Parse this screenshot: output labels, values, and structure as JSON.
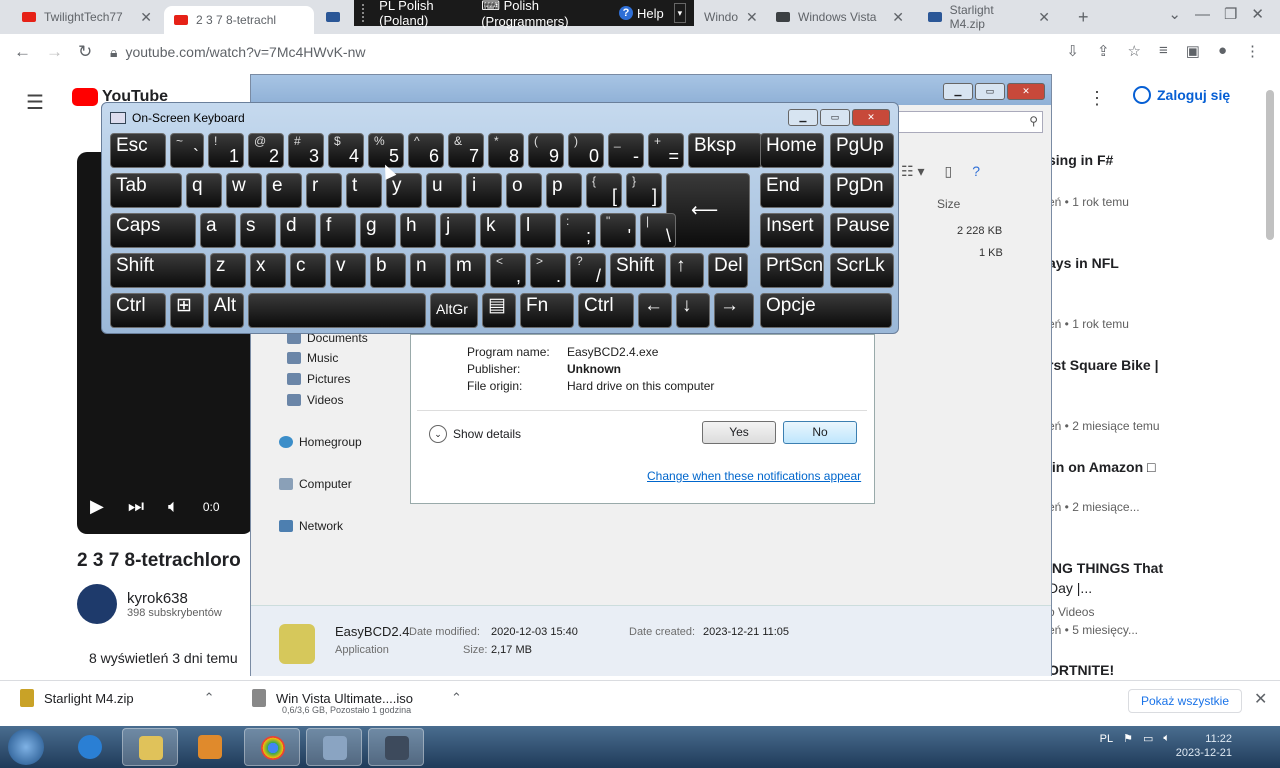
{
  "browser": {
    "tabs": [
      {
        "title": "TwilightTech77",
        "icon": "youtube-icon"
      },
      {
        "title": "2 3 7 8-tetrachl",
        "icon": "youtube-icon"
      },
      {
        "title": "Windo",
        "icon": "windows-icon"
      },
      {
        "title": "Windows Vista",
        "icon": "page-icon"
      },
      {
        "title": "Starlight M4.zip",
        "icon": "windows-icon"
      }
    ],
    "new_tab": "+",
    "url": "youtube.com/watch?v=7Mc4HWvK-nw"
  },
  "language_bar": {
    "language": "PL Polish (Poland)",
    "layout": "Polish (Programmers)",
    "help": "Help"
  },
  "youtube": {
    "logo": "YouTube",
    "sign_in": "Zaloguj się",
    "video_title": "2 3 7 8-tetrachloro",
    "channel": "kyrok638",
    "subscribers": "398 subskrybentów",
    "views": "8 wyświetleń  3 dni temu",
    "time_partial": "0:0",
    "recommendations": [
      {
        "title": "sing in F#",
        "meta": "eń • 1 rok temu"
      },
      {
        "title": "ays in NFL",
        "meta": "eń • 1 rok temu"
      },
      {
        "title": "rst Square Bike |",
        "meta": "eń • 2 miesiące temu"
      },
      {
        "title": "lin on Amazon □",
        "meta": "eń • 2 miesiące..."
      },
      {
        "title": "ING THINGS That",
        "title2": "Day |...",
        "meta": "o Videos",
        "meta2": "eń • 5 miesięcy..."
      },
      {
        "title": "ORTNITE!"
      }
    ]
  },
  "explorer": {
    "column_size": "Size",
    "sizes": [
      "2 228 KB",
      "1 KB"
    ],
    "nav": [
      "Documents",
      "Music",
      "Pictures",
      "Videos",
      "Homegroup",
      "Computer",
      "Network"
    ],
    "details": {
      "name": "EasyBCD2.4",
      "type": "Application",
      "modified_label": "Date modified:",
      "modified": "2020-12-03 15:40",
      "created_label": "Date created:",
      "created": "2023-12-21 11:05",
      "size_label": "Size:",
      "size": "2,17 MB"
    }
  },
  "uac": {
    "program_label": "Program name:",
    "program": "EasyBCD2.4.exe",
    "publisher_label": "Publisher:",
    "publisher": "Unknown",
    "origin_label": "File origin:",
    "origin": "Hard drive on this computer",
    "show_details": "Show details",
    "yes": "Yes",
    "no": "No",
    "link": "Change when these notifications appear"
  },
  "osk": {
    "title": "On-Screen Keyboard",
    "rows": [
      [
        {
          "label": "Esc"
        },
        {
          "top": "~",
          "bottom": "`"
        },
        {
          "top": "!",
          "bottom": "1"
        },
        {
          "top": "@",
          "bottom": "2"
        },
        {
          "top": "#",
          "bottom": "3"
        },
        {
          "top": "$",
          "bottom": "4"
        },
        {
          "top": "%",
          "bottom": "5"
        },
        {
          "top": "^",
          "bottom": "6"
        },
        {
          "top": "&",
          "bottom": "7"
        },
        {
          "top": "*",
          "bottom": "8"
        },
        {
          "top": "(",
          "bottom": "9"
        },
        {
          "top": ")",
          "bottom": "0"
        },
        {
          "top": "_",
          "bottom": "-"
        },
        {
          "top": "+",
          "bottom": "="
        },
        {
          "label": "Bksp"
        },
        {
          "label": "Home"
        },
        {
          "label": "PgUp"
        }
      ],
      [
        {
          "label": "Tab"
        },
        {
          "label": "q"
        },
        {
          "label": "w"
        },
        {
          "label": "e"
        },
        {
          "label": "r"
        },
        {
          "label": "t"
        },
        {
          "label": "y"
        },
        {
          "label": "u"
        },
        {
          "label": "i"
        },
        {
          "label": "o"
        },
        {
          "label": "p"
        },
        {
          "top": "{",
          "bottom": "["
        },
        {
          "top": "}",
          "bottom": "]"
        },
        {
          "label": "⟵"
        },
        {
          "label": "End"
        },
        {
          "label": "PgDn"
        }
      ],
      [
        {
          "label": "Caps"
        },
        {
          "label": "a"
        },
        {
          "label": "s"
        },
        {
          "label": "d"
        },
        {
          "label": "f"
        },
        {
          "label": "g"
        },
        {
          "label": "h"
        },
        {
          "label": "j"
        },
        {
          "label": "k"
        },
        {
          "label": "l"
        },
        {
          "top": ":",
          "bottom": ";"
        },
        {
          "top": "\"",
          "bottom": "'"
        },
        {
          "top": "|",
          "bottom": "\\"
        },
        {
          "label": "Insert"
        },
        {
          "label": "Pause"
        }
      ],
      [
        {
          "label": "Shift"
        },
        {
          "label": "z"
        },
        {
          "label": "x"
        },
        {
          "label": "c"
        },
        {
          "label": "v"
        },
        {
          "label": "b"
        },
        {
          "label": "n"
        },
        {
          "label": "m"
        },
        {
          "top": "<",
          "bottom": ","
        },
        {
          "top": ">",
          "bottom": "."
        },
        {
          "top": "?",
          "bottom": "/"
        },
        {
          "label": "Shift"
        },
        {
          "label": "↑"
        },
        {
          "label": "Del"
        },
        {
          "label": "PrtScn"
        },
        {
          "label": "ScrLk"
        }
      ],
      [
        {
          "label": "Ctrl"
        },
        {
          "label": "⊞"
        },
        {
          "label": "Alt"
        },
        {
          "label": ""
        },
        {
          "label": "AltGr"
        },
        {
          "label": "▤"
        },
        {
          "label": "Fn"
        },
        {
          "label": "Ctrl"
        },
        {
          "label": "←"
        },
        {
          "label": "↓"
        },
        {
          "label": "→"
        },
        {
          "label": "Opcje"
        }
      ]
    ]
  },
  "downloads": {
    "item1": "Starlight M4.zip",
    "item2": "Win Vista Ultimate....iso",
    "item2_status": "0,6/3,6 GB, Pozostało 1 godzina",
    "show_all": "Pokaż wszystkie"
  },
  "taskbar": {
    "lang": "PL",
    "time": "11:22",
    "date": "2023-12-21"
  }
}
